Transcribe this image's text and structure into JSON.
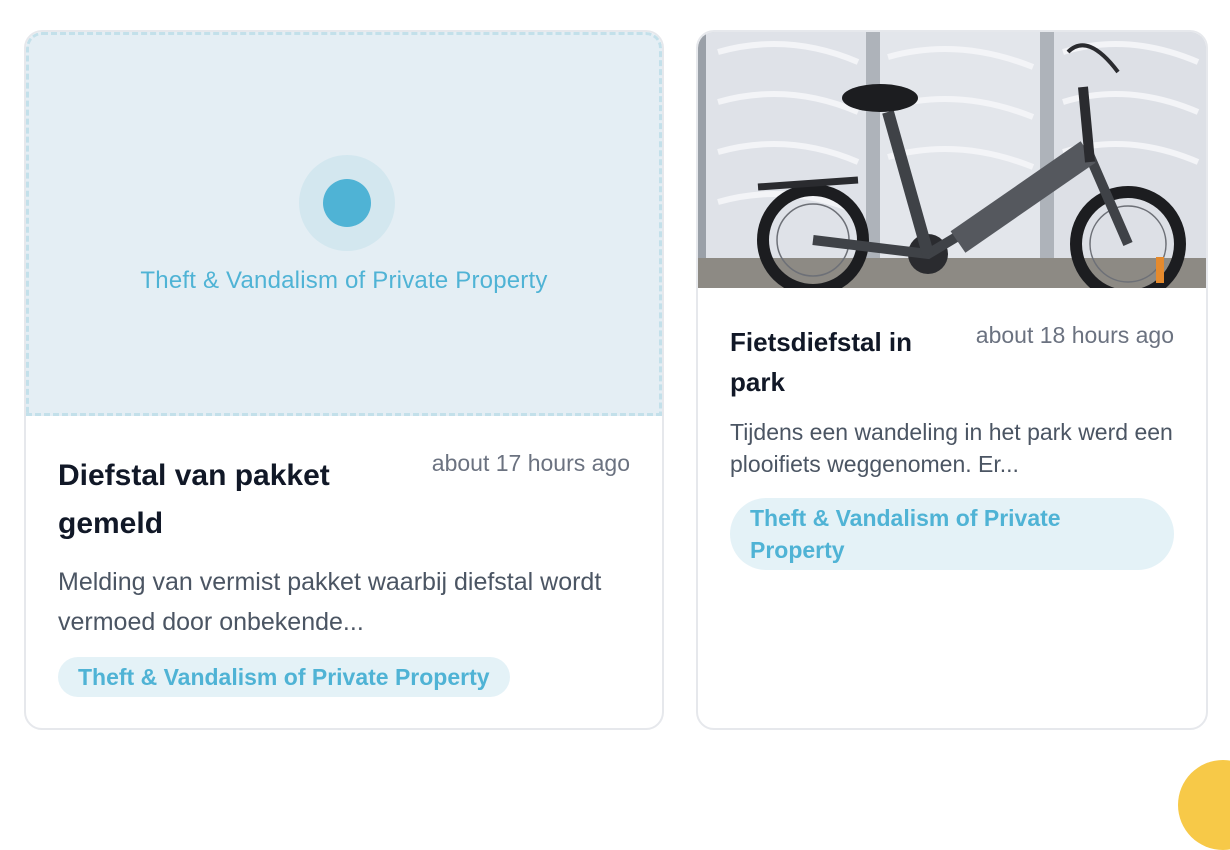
{
  "cards": [
    {
      "placeholder_label": "Theft & Vandalism of Private Property",
      "title": "Diefstal van pakket gemeld",
      "time": "about 17 hours ago",
      "description": "Melding van vermist pakket waarbij diefstal wordt vermoed door onbekende...",
      "category": "Theft & Vandalism of Private Property"
    },
    {
      "title": "Fietsdiefstal in park",
      "time": "about 18 hours ago",
      "description": "Tijdens een wandeling in het park werd een plooifiets weggenomen. Er...",
      "category": "Theft & Vandalism of Private Property"
    }
  ],
  "colors": {
    "accent": "#4fb3d5",
    "tag_background": "#e4f2f7",
    "placeholder_background": "#e4eef4",
    "corner_badge": "#f7c948"
  }
}
